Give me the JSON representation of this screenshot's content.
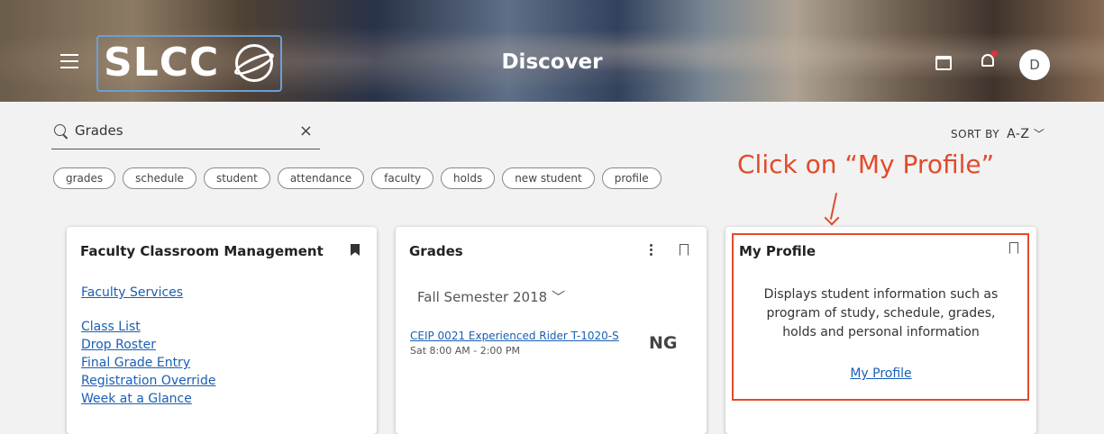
{
  "header": {
    "logo_text": "SLCC",
    "title": "Discover",
    "avatar_initial": "D"
  },
  "search": {
    "value": "Grades",
    "clear_glyph": "×"
  },
  "sort": {
    "label": "SORT BY",
    "value": "A-Z"
  },
  "chips": [
    "grades",
    "schedule",
    "student",
    "attendance",
    "faculty",
    "holds",
    "new student",
    "profile"
  ],
  "annotation": "Click on “My Profile”",
  "cards": {
    "faculty": {
      "title": "Faculty Classroom Management",
      "links": [
        "Faculty Services",
        "Class List",
        "Drop Roster",
        "Final Grade Entry",
        "Registration Override",
        "Week at a Glance"
      ]
    },
    "grades": {
      "title": "Grades",
      "semester": "Fall Semester 2018",
      "course": "CEIP 0021 Experienced Rider T-1020-S",
      "time": "Sat 8:00 AM - 2:00 PM",
      "grade": "NG"
    },
    "profile": {
      "title": "My Profile",
      "description": "Displays student information such as program of study, schedule, grades, holds and personal information",
      "link": "My Profile"
    }
  },
  "colors": {
    "accent": "#e34a2a",
    "link": "#1a5fb4"
  }
}
